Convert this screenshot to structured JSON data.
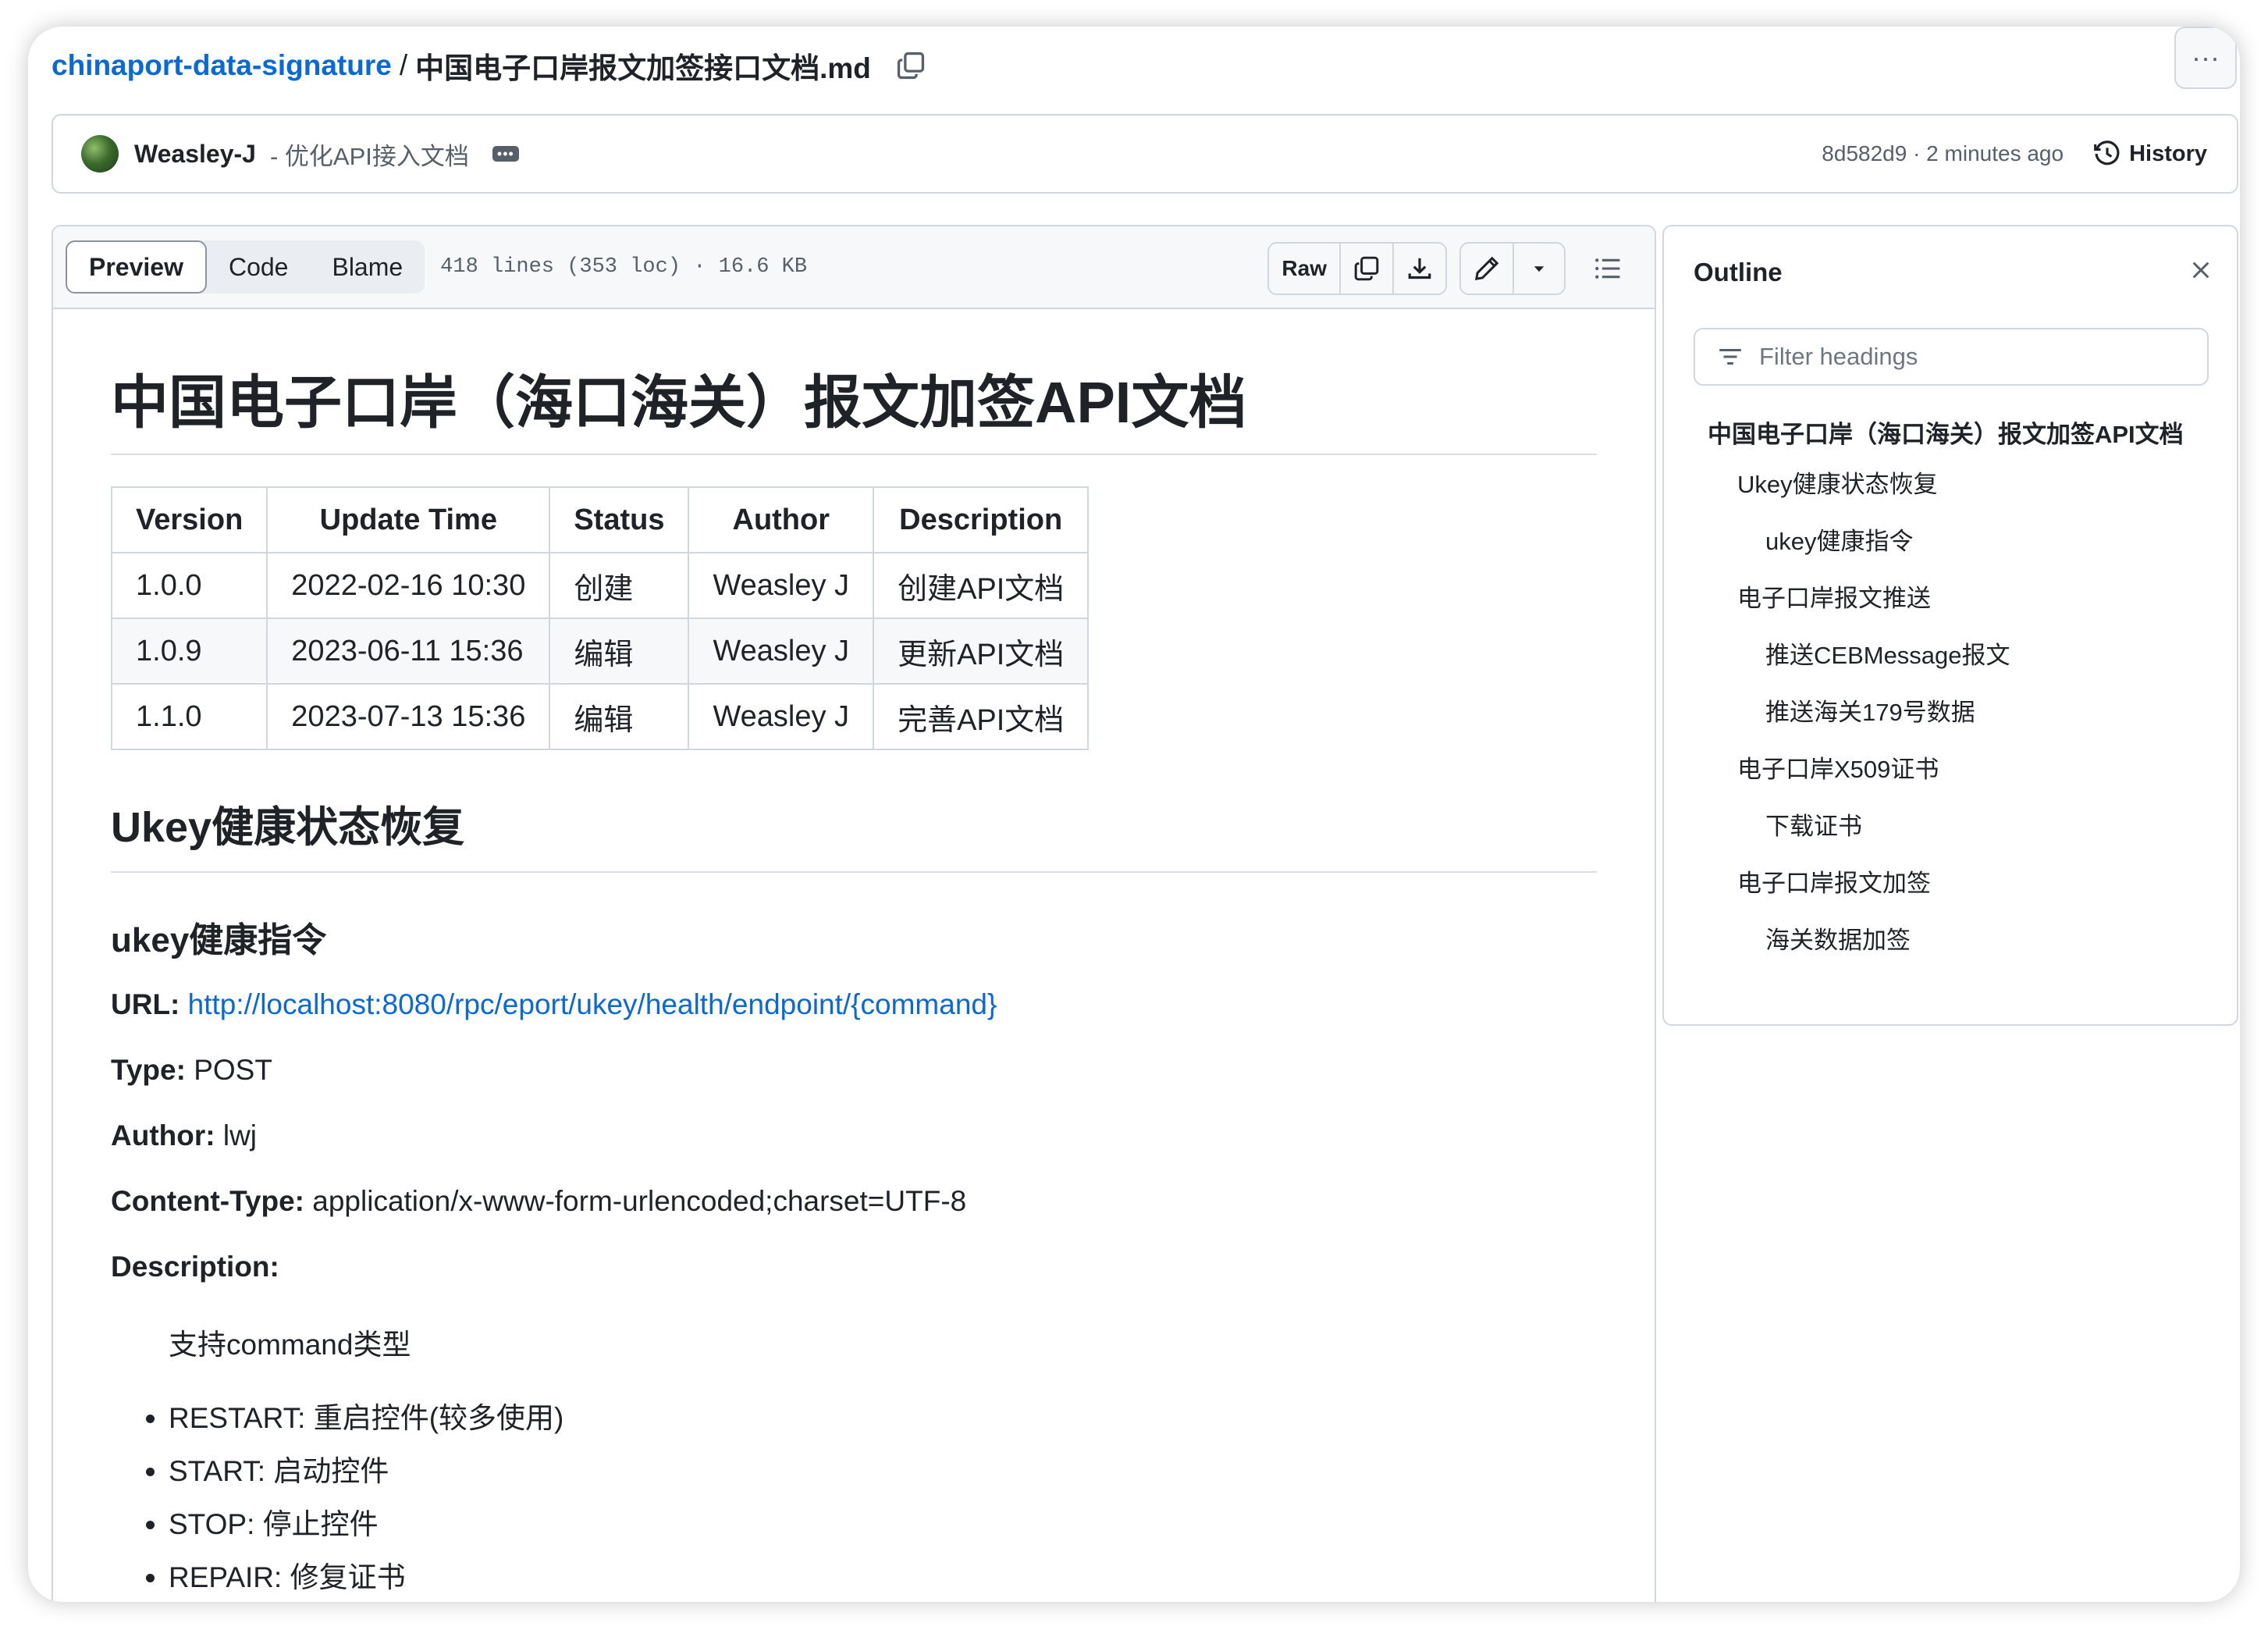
{
  "breadcrumb": {
    "repo": "chinaport-data-signature",
    "separator": "/",
    "file": "中国电子口岸报文加签接口文档.md"
  },
  "commit": {
    "author": "Weasley-J",
    "message": "- 优化API接入文档",
    "hash_time": "8d582d9 · 2 minutes ago",
    "history_label": "History"
  },
  "file_header": {
    "tabs": [
      "Preview",
      "Code",
      "Blame"
    ],
    "info": "418 lines (353 loc) · 16.6 KB",
    "raw_label": "Raw"
  },
  "doc": {
    "title": "中国电子口岸（海口海关）报文加签API文档",
    "table": {
      "headers": [
        "Version",
        "Update Time",
        "Status",
        "Author",
        "Description"
      ],
      "rows": [
        [
          "1.0.0",
          "2022-02-16 10:30",
          "创建",
          "Weasley J",
          "创建API文档"
        ],
        [
          "1.0.9",
          "2023-06-11 15:36",
          "编辑",
          "Weasley J",
          "更新API文档"
        ],
        [
          "1.1.0",
          "2023-07-13 15:36",
          "编辑",
          "Weasley J",
          "完善API文档"
        ]
      ]
    },
    "section_title": "Ukey健康状态恢复",
    "subsection_title": "ukey健康指令",
    "url_label": "URL:",
    "url_value": "http://localhost:8080/rpc/eport/ukey/health/endpoint/{command}",
    "type_label": "Type:",
    "type_value": "POST",
    "author_label": "Author:",
    "author_value": "lwj",
    "content_type_label": "Content-Type:",
    "content_type_value": "application/x-www-form-urlencoded;charset=UTF-8",
    "description_label": "Description:",
    "description_text": "支持command类型",
    "commands": [
      "RESTART: 重启控件(较多使用)",
      "START: 启动控件",
      "STOP: 停止控件",
      "REPAIR: 修复证书"
    ]
  },
  "outline": {
    "title": "Outline",
    "filter_placeholder": "Filter headings",
    "items": [
      "中国电子口岸（海口海关）报文加签API文档",
      "Ukey健康状态恢复",
      "ukey健康指令",
      "电子口岸报文推送",
      "推送CEBMessage报文",
      "推送海关179号数据",
      "电子口岸X509证书",
      "下载证书",
      "电子口岸报文加签",
      "海关数据加签"
    ]
  },
  "colors": {
    "link": "#0969da",
    "border": "#d0d7de",
    "muted": "#57606a"
  }
}
